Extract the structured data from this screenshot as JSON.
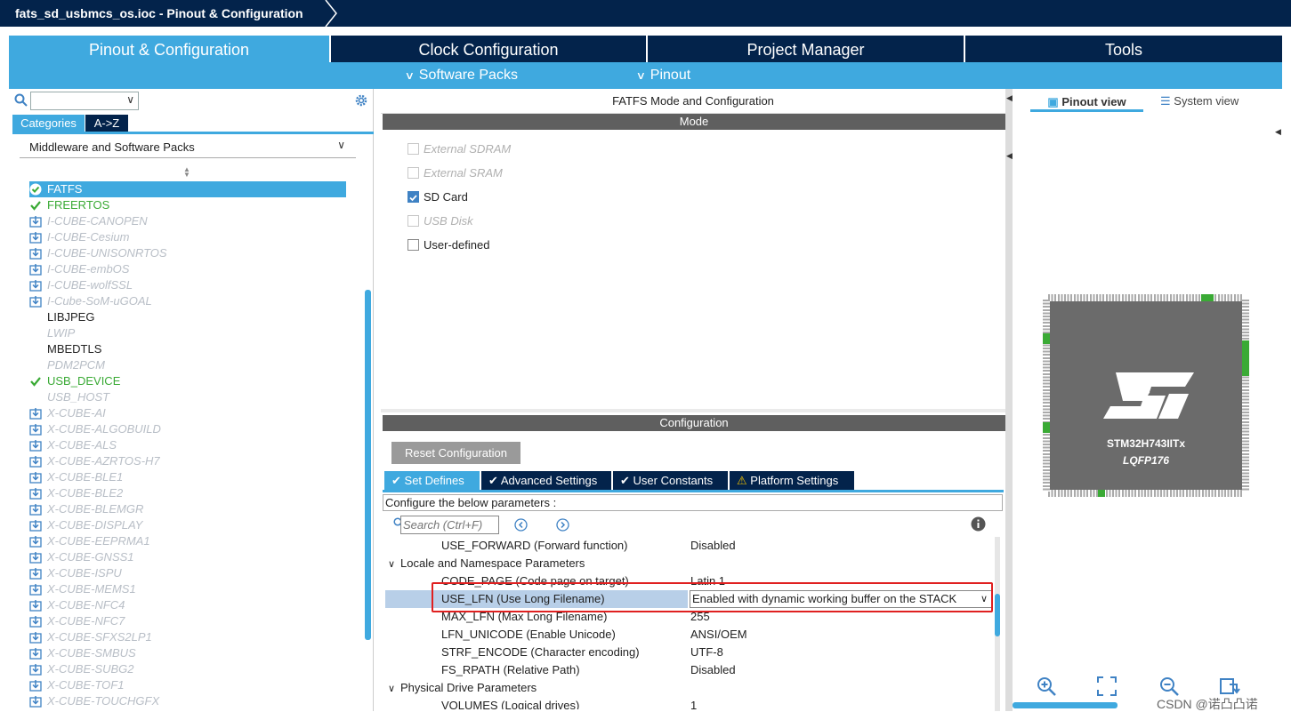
{
  "window": {
    "title": "fats_sd_usbmcs_os.ioc - Pinout & Configuration"
  },
  "main_tabs": [
    {
      "label": "Pinout & Configuration"
    },
    {
      "label": "Clock Configuration"
    },
    {
      "label": "Project Manager"
    },
    {
      "label": "Tools"
    }
  ],
  "sub_menu": {
    "software_packs": "Software Packs",
    "pinout": "Pinout"
  },
  "left": {
    "search_value": "",
    "tab_categories": "Categories",
    "tab_az": "A->Z",
    "section": "Middleware and Software Packs",
    "items": [
      {
        "label": "FATFS",
        "state": "selected"
      },
      {
        "label": "FREERTOS",
        "state": "enabled"
      },
      {
        "label": "I-CUBE-CANOPEN",
        "state": "pack"
      },
      {
        "label": "I-CUBE-Cesium",
        "state": "pack"
      },
      {
        "label": "I-CUBE-UNISONRTOS",
        "state": "pack"
      },
      {
        "label": "I-CUBE-embOS",
        "state": "pack"
      },
      {
        "label": "I-CUBE-wolfSSL",
        "state": "pack"
      },
      {
        "label": "I-Cube-SoM-uGOAL",
        "state": "pack"
      },
      {
        "label": "LIBJPEG",
        "state": "normal"
      },
      {
        "label": "LWIP",
        "state": "disabled"
      },
      {
        "label": "MBEDTLS",
        "state": "normal"
      },
      {
        "label": "PDM2PCM",
        "state": "disabled"
      },
      {
        "label": "USB_DEVICE",
        "state": "enabled"
      },
      {
        "label": "USB_HOST",
        "state": "disabled"
      },
      {
        "label": "X-CUBE-AI",
        "state": "pack"
      },
      {
        "label": "X-CUBE-ALGOBUILD",
        "state": "pack"
      },
      {
        "label": "X-CUBE-ALS",
        "state": "pack"
      },
      {
        "label": "X-CUBE-AZRTOS-H7",
        "state": "pack"
      },
      {
        "label": "X-CUBE-BLE1",
        "state": "pack"
      },
      {
        "label": "X-CUBE-BLE2",
        "state": "pack"
      },
      {
        "label": "X-CUBE-BLEMGR",
        "state": "pack"
      },
      {
        "label": "X-CUBE-DISPLAY",
        "state": "pack"
      },
      {
        "label": "X-CUBE-EEPRMA1",
        "state": "pack"
      },
      {
        "label": "X-CUBE-GNSS1",
        "state": "pack"
      },
      {
        "label": "X-CUBE-ISPU",
        "state": "pack"
      },
      {
        "label": "X-CUBE-MEMS1",
        "state": "pack"
      },
      {
        "label": "X-CUBE-NFC4",
        "state": "pack"
      },
      {
        "label": "X-CUBE-NFC7",
        "state": "pack"
      },
      {
        "label": "X-CUBE-SFXS2LP1",
        "state": "pack"
      },
      {
        "label": "X-CUBE-SMBUS",
        "state": "pack"
      },
      {
        "label": "X-CUBE-SUBG2",
        "state": "pack"
      },
      {
        "label": "X-CUBE-TOF1",
        "state": "pack"
      },
      {
        "label": "X-CUBE-TOUCHGFX",
        "state": "pack"
      }
    ]
  },
  "middle": {
    "title": "FATFS Mode and Configuration",
    "mode_header": "Mode",
    "mode_options": [
      {
        "label": "External SDRAM",
        "checked": false,
        "disabled": true
      },
      {
        "label": "External SRAM",
        "checked": false,
        "disabled": true
      },
      {
        "label": "SD Card",
        "checked": true,
        "disabled": false
      },
      {
        "label": "USB Disk",
        "checked": false,
        "disabled": true
      },
      {
        "label": "User-defined",
        "checked": false,
        "disabled": false
      }
    ],
    "config_header": "Configuration",
    "reset_button": "Reset Configuration",
    "tabs": [
      {
        "label": "Set Defines",
        "icon": "check-circle-icon"
      },
      {
        "label": "Advanced Settings",
        "icon": "check-circle-icon"
      },
      {
        "label": "User Constants",
        "icon": "check-circle-icon"
      },
      {
        "label": "Platform Settings",
        "icon": "warning-icon"
      }
    ],
    "configure_text": "Configure the below parameters :",
    "search_placeholder": "Search (Ctrl+F)",
    "params": {
      "use_forward": {
        "name": "USE_FORWARD (Forward function)",
        "value": "Disabled"
      },
      "group_locale": "Locale and Namespace Parameters",
      "code_page": {
        "name": "CODE_PAGE (Code page on target)",
        "value": "Latin 1"
      },
      "use_lfn": {
        "name": "USE_LFN (Use Long Filename)",
        "value": "Enabled with dynamic working buffer on the STACK"
      },
      "max_lfn": {
        "name": "MAX_LFN (Max Long Filename)",
        "value": "255"
      },
      "lfn_unicode": {
        "name": "LFN_UNICODE (Enable Unicode)",
        "value": "ANSI/OEM"
      },
      "strf_encode": {
        "name": "STRF_ENCODE (Character encoding)",
        "value": "UTF-8"
      },
      "fs_rpath": {
        "name": "FS_RPATH (Relative Path)",
        "value": "Disabled"
      },
      "group_physical": "Physical Drive Parameters",
      "volumes": {
        "name": "VOLUMES (Logical drives)",
        "value": "1"
      }
    }
  },
  "right": {
    "pinout_view": "Pinout view",
    "system_view": "System view",
    "chip_name": "STM32H743IITx",
    "chip_package": "LQFP176",
    "watermark": "CSDN @诺凸凸诺"
  },
  "colors": {
    "navy": "#03234b",
    "accent": "#3fa9df",
    "green": "#3aaa35",
    "highlight_red": "#e02020"
  }
}
